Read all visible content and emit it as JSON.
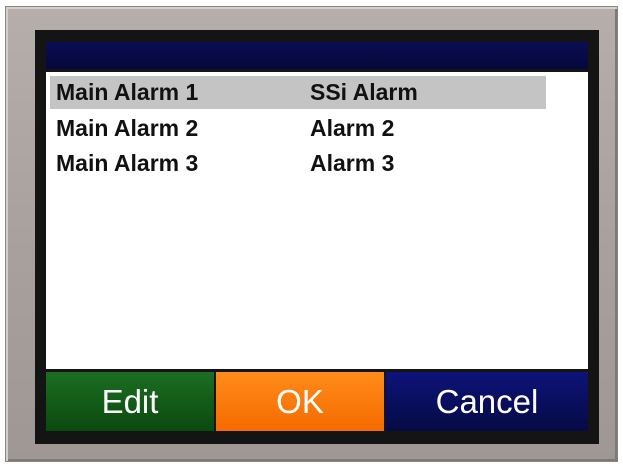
{
  "list": {
    "rows": [
      {
        "name": "Main Alarm 1",
        "value": "SSi Alarm",
        "selected": true
      },
      {
        "name": "Main Alarm 2",
        "value": "Alarm 2",
        "selected": false
      },
      {
        "name": "Main Alarm 3",
        "value": "Alarm 3",
        "selected": false
      }
    ]
  },
  "buttons": {
    "edit": "Edit",
    "ok": "OK",
    "cancel": "Cancel"
  },
  "colors": {
    "title_bar": "#0a0d52",
    "edit_button": "#1c6e22",
    "ok_button": "#ff8c1a",
    "cancel_button": "#0d137a",
    "selection": "#c4c4c4"
  }
}
